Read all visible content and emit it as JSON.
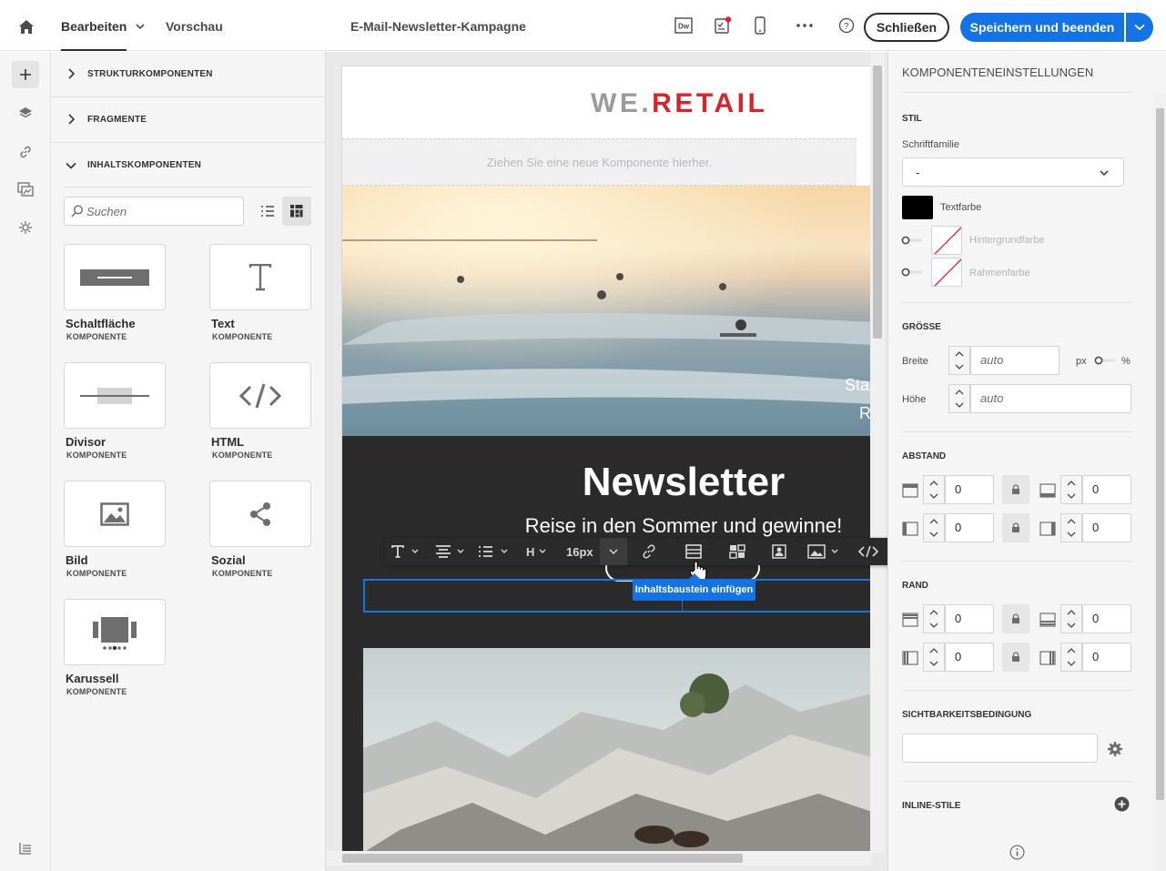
{
  "topbar": {
    "tab_edit": "Bearbeiten",
    "tab_preview": "Vorschau",
    "doc_title": "E-Mail-Newsletter-Kampagne",
    "dw_label": "Dw",
    "close_label": "Schließen",
    "save_label": "Speichern und beenden"
  },
  "components_panel": {
    "sections": [
      "STRUKTURKOMPONENTEN",
      "FRAGMENTE",
      "INHALTSKOMPONENTEN"
    ],
    "search_placeholder": "Suchen",
    "tiles": [
      {
        "name": "Schaltfläche",
        "sub": "KOMPONENTE"
      },
      {
        "name": "Text",
        "sub": "KOMPONENTE"
      },
      {
        "name": "Divisor",
        "sub": "KOMPONENTE"
      },
      {
        "name": "HTML",
        "sub": "KOMPONENTE"
      },
      {
        "name": "Bild",
        "sub": "KOMPONENTE"
      },
      {
        "name": "Sozial",
        "sub": "KOMPONENTE"
      },
      {
        "name": "Karussell",
        "sub": "KOMPONENTE"
      }
    ]
  },
  "email": {
    "logo_we": "WE.",
    "logo_retail": "RETAIL",
    "dropzone_text": "Ziehen Sie eine neue Komponente hierher.",
    "hero_overlay_1": "Sta",
    "hero_overlay_2": "R",
    "newsletter_title": "Newsletter",
    "newsletter_sub": "Reise in den Sommer und gewinne!"
  },
  "rte_toolbar": {
    "font_size": "16px",
    "heading": "H",
    "tooltip": "Inhaltsbaustein einfügen"
  },
  "settings": {
    "title": "KOMPONENTENEINSTELLUNGEN",
    "sec_style": "STIL",
    "font_family_label": "Schriftfamilie",
    "font_family_value": "-",
    "text_color_label": "Textfarbe",
    "text_color": "#000000",
    "bg_color_label": "Hintergrundfarbe",
    "border_color_label": "Rahmenfarbe",
    "sec_size": "GRÖSSE",
    "width_label": "Breite",
    "width_placeholder": "auto",
    "unit_px": "px",
    "unit_pct": "%",
    "height_label": "Höhe",
    "height_placeholder": "auto",
    "sec_spacing": "ABSTAND",
    "spacing": [
      "0",
      "0",
      "0",
      "0"
    ],
    "sec_border": "RAND",
    "border": [
      "0",
      "0",
      "0",
      "0"
    ],
    "sec_visibility": "SICHTBARKEITSBEDINGUNG",
    "sec_inline": "INLINE-STILE"
  },
  "colors": {
    "accent": "#1473e6",
    "retail_red": "#d8232a",
    "dark_block": "#2b2b2b"
  }
}
